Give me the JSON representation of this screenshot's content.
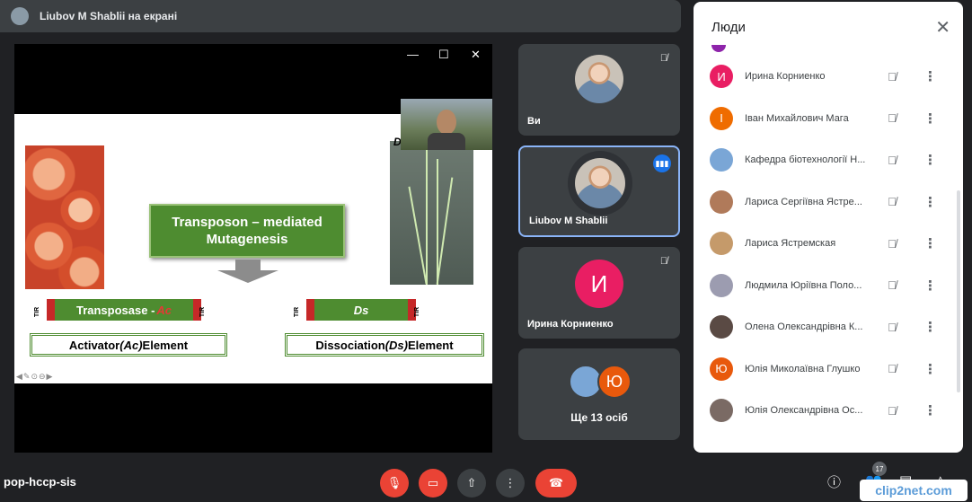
{
  "topbar": {
    "presenter_text": "Liubov M Shablii на екрані"
  },
  "stage": {
    "window_controls": {
      "minimize": "—",
      "maximize": "☐",
      "close": "✕"
    },
    "slide": {
      "d_letter": "D",
      "title": "Transposon – mediated Mutagenesis",
      "ac_gene_prefix": "Transposase -",
      "ac_gene_italic": "Ac",
      "ds_gene": "Ds",
      "tir_label": "TIR",
      "activator_prefix": "Activator ",
      "activator_italic": "(Ac)",
      "activator_suffix": " Element",
      "dissociation_prefix": "Dissociation ",
      "dissociation_italic": "(Ds)",
      "dissociation_suffix": " Element",
      "nav_icons": "◀✎⊙⊖▶"
    }
  },
  "tiles": [
    {
      "name": "Ви",
      "muted": true
    },
    {
      "name": "Liubov M Shablii",
      "speaking": true
    },
    {
      "name": "Ирина Корниенко",
      "initial": "И",
      "color": "#e91e63",
      "muted": true
    },
    {
      "name": "Ще 13 осіб",
      "initial": "Ю",
      "color": "#e8590c"
    }
  ],
  "panel": {
    "title": "Люди",
    "participants": [
      {
        "name": "Ирина Корниенко",
        "initial": "И",
        "color": "#e91e63"
      },
      {
        "name": "Іван Михайлович Мага",
        "initial": "І",
        "color": "#ef6c00"
      },
      {
        "name": "Кафедра біотехнології Н...",
        "initial": "",
        "color": "#7aa6d6"
      },
      {
        "name": "Лариса Сергіївна Ястре...",
        "initial": "",
        "color": "#b07a5a"
      },
      {
        "name": "Лариса Ястремская",
        "initial": "",
        "color": "#c59a6a"
      },
      {
        "name": "Людмила Юріївна Поло...",
        "initial": "",
        "color": "#9c9cb0"
      },
      {
        "name": "Олена Олександрівна К...",
        "initial": "",
        "color": "#5a4a44"
      },
      {
        "name": "Юлія Миколаївна Глушко",
        "initial": "Ю",
        "color": "#e8590c"
      },
      {
        "name": "Юлія Олександрівна Ос...",
        "initial": "",
        "color": "#7a6a64"
      }
    ]
  },
  "bottom": {
    "meeting_code": "pop-hccp-sis",
    "people_count": "17",
    "watermark": "clip2net.com"
  }
}
